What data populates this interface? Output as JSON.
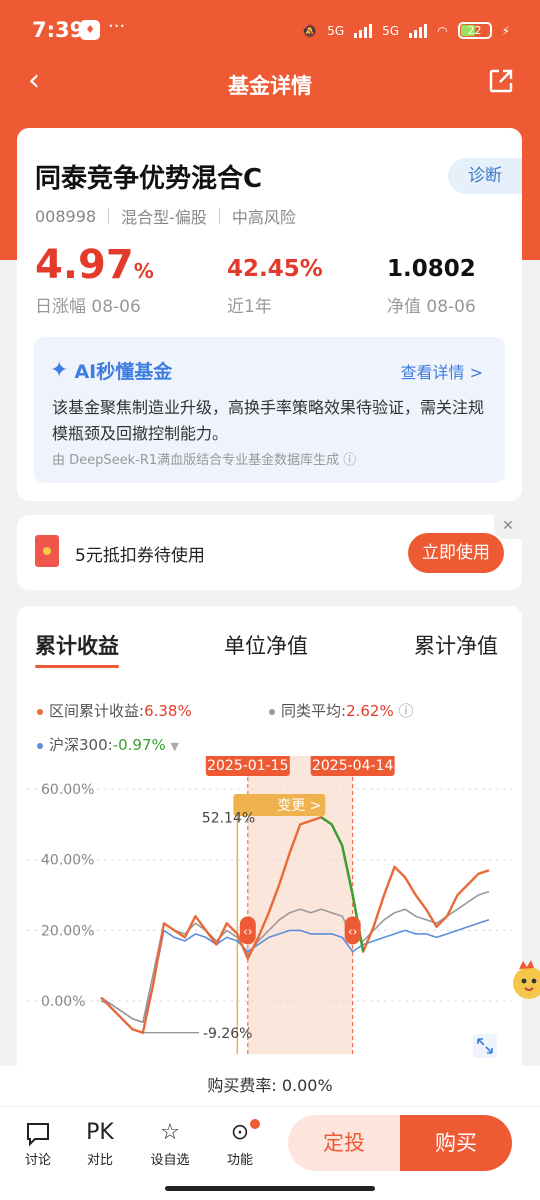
{
  "status": {
    "time": "7:39",
    "dots": "···",
    "sig1": "5G",
    "sig2": "5G",
    "battery": "22"
  },
  "nav": {
    "title": "基金详情"
  },
  "fund": {
    "name": "同泰竞争优势混合C",
    "diagnose": "诊断",
    "code": "008998",
    "type": "混合型-偏股",
    "risk": "中高风险",
    "daily_value": "4.97",
    "daily_unit": "%",
    "daily_label": "日涨幅 08-06",
    "year_value": "42.45%",
    "year_label": "近1年",
    "nav_value": "1.0802",
    "nav_label": "净值 08-06"
  },
  "ai": {
    "title": "AI秒懂基金",
    "more": "查看详情 >",
    "body": "该基金聚焦制造业升级，高换手率策略效果待验证，需关注规模瓶颈及回撤控制能力。",
    "source": "由 DeepSeek-R1满血版结合专业基金数据库生成 ⓘ"
  },
  "coupon": {
    "text": "5元抵扣券待使用",
    "button": "立即使用",
    "close": "✕"
  },
  "tabs": [
    "累计收益",
    "单位净值",
    "累计净值"
  ],
  "legend": {
    "fund_label": "区间累计收益:",
    "fund_value": "6.38%",
    "avg_label": "同类平均:",
    "avg_value": "2.62%",
    "hs_label": "沪深300:",
    "hs_value": "-0.97%"
  },
  "markers": {
    "start": "2025-01-15",
    "end": "2025-04-14",
    "peak": "52.14%",
    "low": "-9.26%",
    "change": "变更 >"
  },
  "colors": {
    "fund": "#e8693a",
    "avg": "#9a9a9a",
    "hs": "#5b8fdb",
    "up": "#e33b2b",
    "down": "#36a030",
    "brand": "#ee5a33"
  },
  "chart_data": {
    "type": "line",
    "yticks": [
      "60.00%",
      "40.00%",
      "20.00%",
      "0.00%"
    ],
    "ylim": [
      -15,
      62
    ],
    "series": [
      {
        "name": "区间累计收益",
        "values": [
          1,
          -2,
          -5,
          -8,
          -9,
          5,
          22,
          20,
          18,
          24,
          20,
          16,
          22,
          19,
          12,
          18,
          25,
          33,
          42,
          50,
          51,
          52,
          50,
          44,
          30,
          14,
          21,
          30,
          38,
          35,
          30,
          26,
          21,
          24,
          30,
          33,
          36,
          37
        ]
      },
      {
        "name": "同类平均",
        "values": [
          0,
          -1,
          -3,
          -5,
          -6,
          8,
          22,
          20,
          19,
          22,
          20,
          17,
          20,
          18,
          13,
          17,
          20,
          23,
          25,
          26,
          25,
          26,
          25,
          24,
          18,
          17,
          20,
          23,
          25,
          26,
          24,
          23,
          22,
          24,
          26,
          28,
          30,
          31
        ]
      },
      {
        "name": "沪深300",
        "values": [
          1,
          -1,
          -3,
          -5,
          -6,
          5,
          20,
          18,
          17,
          19,
          18,
          16,
          18,
          17,
          14,
          16,
          18,
          19,
          20,
          20,
          19,
          19,
          19,
          18,
          14,
          16,
          17,
          18,
          19,
          20,
          19,
          19,
          18,
          19,
          20,
          21,
          22,
          23
        ]
      }
    ]
  },
  "fee": "购买费率: 0.00%",
  "bottom": {
    "discuss": "讨论",
    "pk": "对比",
    "pk_icon": "PK",
    "watch": "设自选",
    "func": "功能",
    "ding": "定投",
    "buy": "购买"
  }
}
